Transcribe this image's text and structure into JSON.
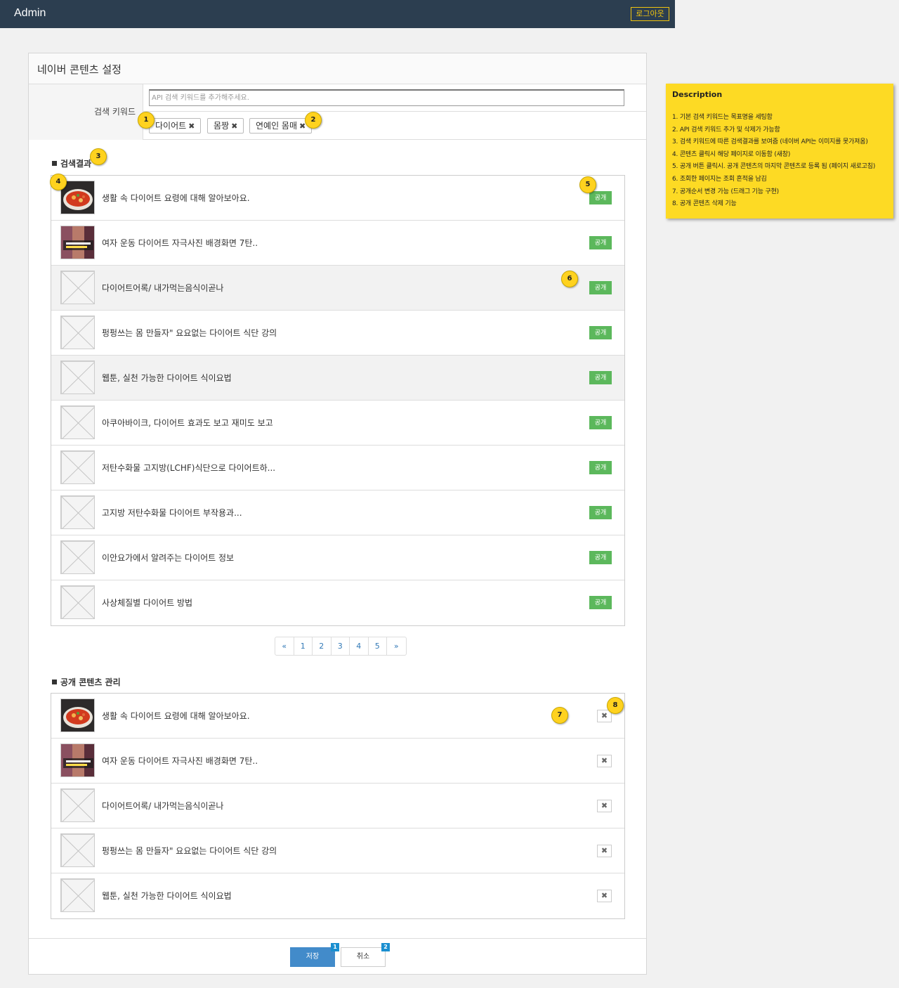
{
  "header": {
    "brand": "Admin",
    "logout_label": "로그아웃"
  },
  "panel": {
    "title": "네이버 콘텐츠 설정"
  },
  "keyword": {
    "label": "검색 키워드",
    "placeholder": "API 검색 키워드를 추가해주세요.",
    "tags": [
      "다이어트",
      "몸짱",
      "연예인 몸매"
    ],
    "remove_glyph": "✖"
  },
  "results": {
    "title": "검색결과",
    "publish_label": "공개",
    "items": [
      {
        "title": "생활 속 다이어트 요령에 대해 알아보아요.",
        "thumb": "food"
      },
      {
        "title": "여자 운동 다이어트 자극사진 배경화면 7탄..",
        "thumb": "photo"
      },
      {
        "title": "다이어트어록/ 내가먹는음식이곧나",
        "thumb": "placeholder"
      },
      {
        "title": "펑펑쓰는 몸 만들자\" 요요없는 다이어트 식단 강의",
        "thumb": "placeholder"
      },
      {
        "title": "웹툰, 실천 가능한 다이어트 식이요법",
        "thumb": "placeholder"
      },
      {
        "title": "아쿠아바이크, 다이어트 효과도 보고 재미도 보고",
        "thumb": "placeholder"
      },
      {
        "title": "저탄수화물 고지방(LCHF)식단으로 다이어트하...",
        "thumb": "placeholder"
      },
      {
        "title": "고지방 저탄수화물 다이어트 부작용과...",
        "thumb": "placeholder"
      },
      {
        "title": "이안요가에서 알려주는 다이어트 정보",
        "thumb": "placeholder"
      },
      {
        "title": "사상체질별 다이어트 방법",
        "thumb": "placeholder"
      }
    ]
  },
  "pagination": [
    "«",
    "1",
    "2",
    "3",
    "4",
    "5",
    "»"
  ],
  "published": {
    "title": "공개 콘텐츠 관리",
    "remove_glyph": "✖",
    "items": [
      {
        "title": "생활 속 다이어트 요령에 대해 알아보아요.",
        "thumb": "food"
      },
      {
        "title": "여자 운동 다이어트 자극사진 배경화면 7탄..",
        "thumb": "photo"
      },
      {
        "title": "다이어트어록/ 내가먹는음식이곧나",
        "thumb": "placeholder"
      },
      {
        "title": "펑펑쓰는 몸 만들자\" 요요없는 다이어트 식단 강의",
        "thumb": "placeholder"
      },
      {
        "title": "웹툰, 실천 가능한 다이어트 식이요법",
        "thumb": "placeholder"
      }
    ]
  },
  "actions": {
    "save_label": "저장",
    "cancel_label": "취소",
    "save_badge": "1",
    "cancel_badge": "2"
  },
  "markers": [
    "1",
    "2",
    "3",
    "4",
    "5",
    "6",
    "7",
    "8"
  ],
  "description": {
    "title": "Description",
    "items": [
      "1. 기본 검색 키워드는 목표명을 세팅함",
      "2. API 검색 키워드 추가 및 삭제가 가능함",
      "3. 검색 키워드에 따른 검색결과를 보여줌 (네이버 API는 이미지를 못가져옴)",
      "4. 콘텐츠 클릭시 해당 페이지로 이동함 (새창)",
      "5. 공개 버튼 클릭시. 공개 콘텐츠의 마지막 콘텐츠로 등록 됨 (페이지 새로고침)",
      "6. 조회한 페이지는 조회 흔적을 남김",
      "7. 공개순서 변경 가능 (드래그 기능 구현)",
      "8. 공개 콘텐츠 삭제 기능"
    ]
  },
  "colors": {
    "topbar": "#2c3e50",
    "publish": "#5cb85c",
    "save": "#428bca",
    "note": "#fdda24",
    "marker": "#ffd21f"
  }
}
